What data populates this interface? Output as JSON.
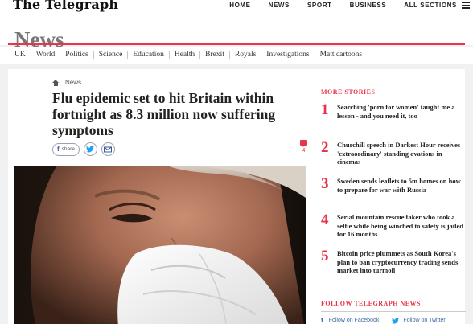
{
  "masthead": {
    "logo": "The Telegraph",
    "nav": [
      "HOME",
      "NEWS",
      "SPORT",
      "BUSINESS",
      "ALL SECTIONS"
    ],
    "menu_icon": "hamburger-menu-icon"
  },
  "section": {
    "title": "News"
  },
  "subnav": [
    "UK",
    "World",
    "Politics",
    "Science",
    "Education",
    "Health",
    "Brexit",
    "Royals",
    "Investigations",
    "Matt cartoons"
  ],
  "article": {
    "breadcrumb": "News",
    "headline": "Flu epidemic set to hit Britain within fortnight as 8.3 million now suffering symptoms",
    "share_facebook": "share",
    "comment_count": "4"
  },
  "sidebar": {
    "title": "MORE STORIES",
    "stories": [
      {
        "num": "1",
        "text": "Searching 'porn for women' taught me a lesson - and you need it, too"
      },
      {
        "num": "2",
        "text": "Churchill speech in Darkest Hour receives 'extraordinary' standing ovations in cinemas"
      },
      {
        "num": "3",
        "text": "Sweden sends leaflets to 5m homes on how to prepare for war with Russia"
      },
      {
        "num": "4",
        "text": "Serial mountain rescue faker who took a selfie while being winched to safety is jailed for 16 months"
      },
      {
        "num": "5",
        "text": "Bitcoin price plummets as South Korea's plan to ban cryptocurrency trading sends market into turmoil"
      }
    ],
    "follow_title": "FOLLOW TELEGRAPH NEWS",
    "follow_facebook": "Follow on Facebook",
    "follow_twitter": "Follow on Twitter"
  },
  "colors": {
    "accent": "#e8354b",
    "facebook": "#3b5998",
    "twitter": "#1da1f2"
  }
}
